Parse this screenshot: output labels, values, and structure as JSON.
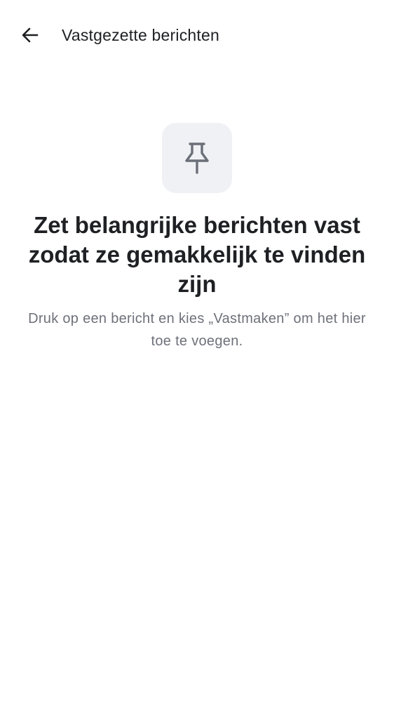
{
  "app_bar": {
    "back_icon": "arrow-left-icon",
    "title": "Vastgezette berichten"
  },
  "empty_state": {
    "icon": "pushpin-icon",
    "heading": "Zet belangrijke berichten vast zodat ze gemakkelijk te vinden zijn",
    "body": "Druk op een bericht en kies „Vastmaken” om het hier toe te voegen."
  },
  "colors": {
    "title_text": "#1f2024",
    "body_text": "#6e717a",
    "icon_tile_bg": "#f0f1f5",
    "icon_stroke": "#6b6f78",
    "background": "#ffffff"
  }
}
